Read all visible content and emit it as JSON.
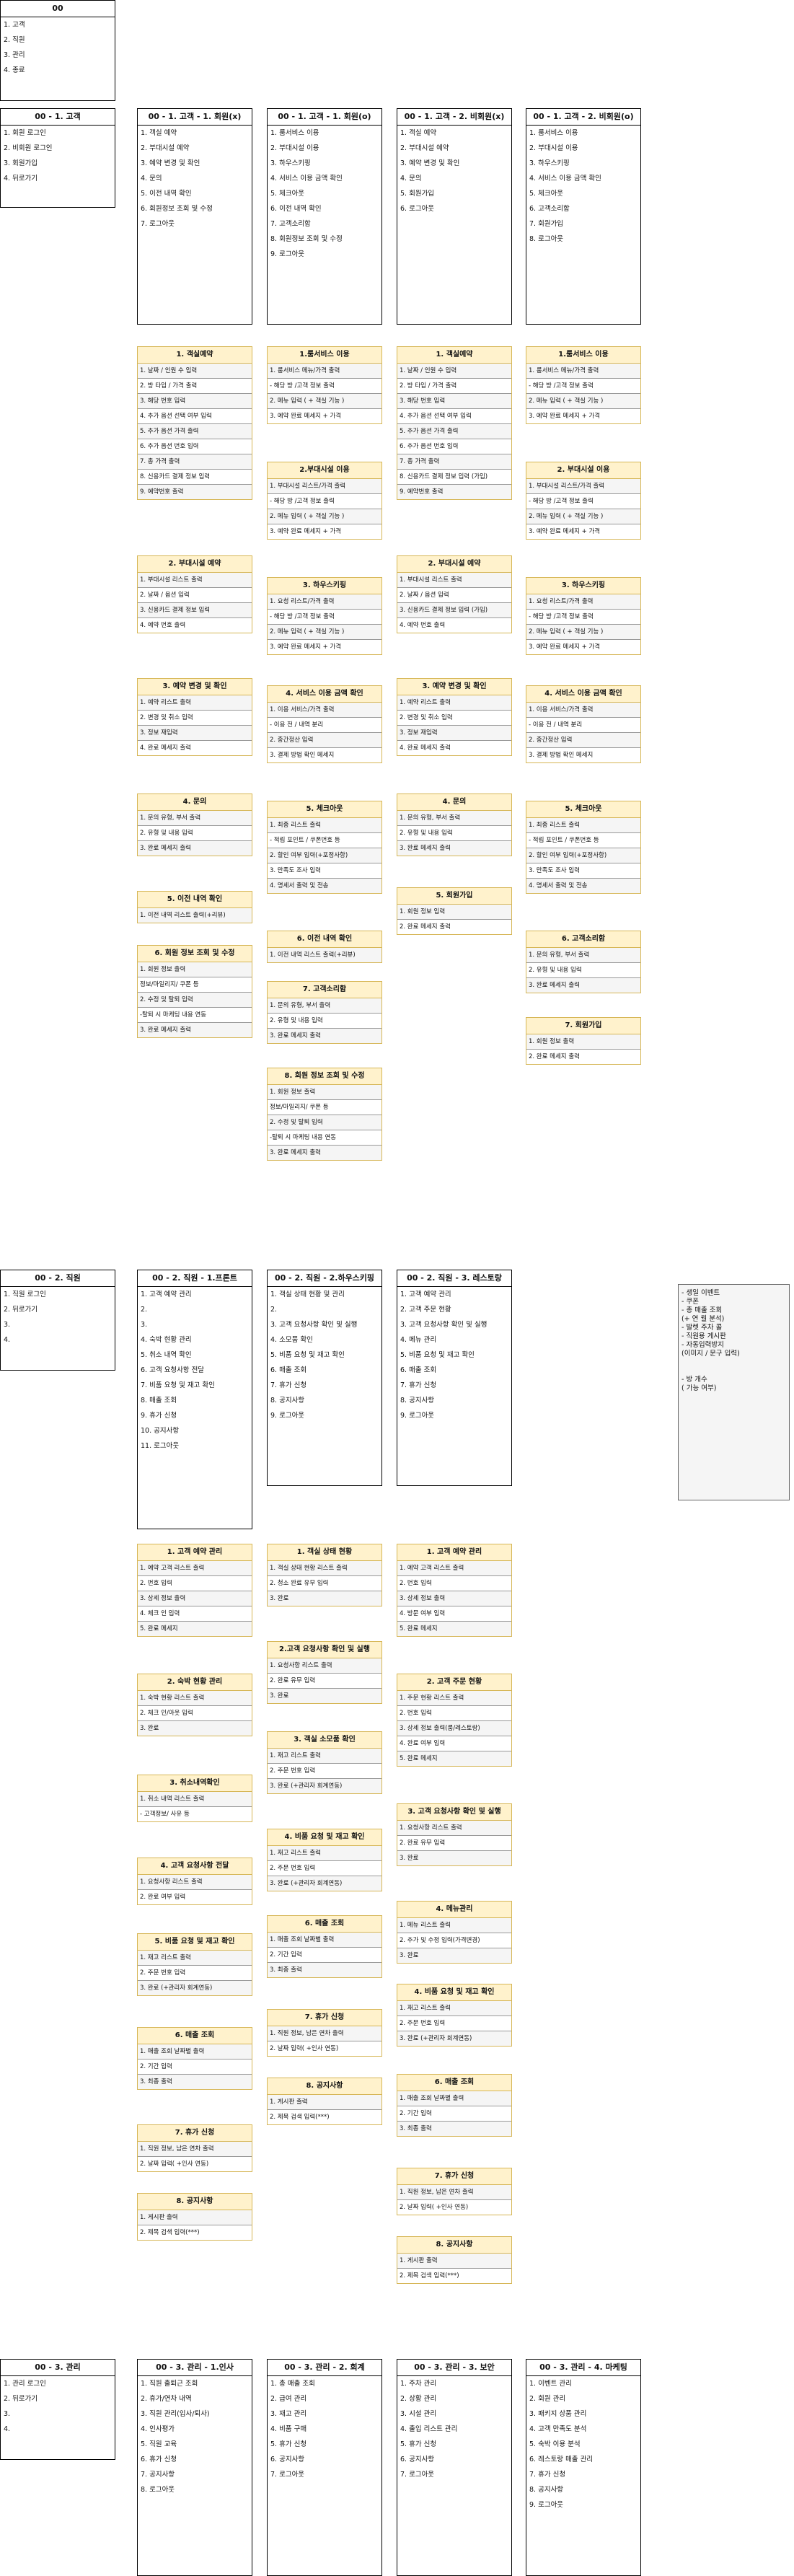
{
  "boxes": [
    {
      "title": "00",
      "lines": [
        "1. 고객",
        "2. 직원",
        "3. 관리",
        "4. 종료"
      ]
    },
    {
      "title": "00 - 1. 고객",
      "lines": [
        "1. 회원 로그인",
        "2. 비회원 로그인",
        "3. 회원가입",
        "4. 뒤로가기"
      ]
    },
    {
      "title": "00 - 1. 고객 - 1. 회원(x)",
      "lines": [
        "1. 객실 예약",
        "2. 부대시설 예약",
        "3. 예약 변경 및 확인",
        "4. 문의",
        "5. 이전 내역 확인",
        "6. 회원정보 조회 및 수정",
        "7. 로그아웃"
      ]
    },
    {
      "title": "00 - 1. 고객 - 1. 회원(o)",
      "lines": [
        "1. 룸서비스 이용",
        "2. 부대시설 이용",
        "3. 하우스키핑",
        "4. 서비스 이용 금액 확인",
        "5. 체크아웃",
        "6. 이전 내역 확인",
        "7. 고객소리함",
        "8. 회원정보 조회 및 수정",
        "9. 로그아웃"
      ]
    },
    {
      "title": "00 - 1. 고객 - 2. 비회원(x)",
      "lines": [
        "1. 객실 예약",
        "2. 부대시설 예약",
        "3. 예약 변경 및 확인",
        "4. 문의",
        "5. 회원가입",
        "6. 로그아웃"
      ]
    },
    {
      "title": "00 - 1. 고객 - 2. 비회원(o)",
      "lines": [
        "1. 룸서비스 이용",
        "2. 부대시설 이용",
        "3. 하우스키핑",
        "4. 서비스 이용 금액 확인",
        "5. 체크아웃",
        "6. 고객소리함",
        "7. 회원가입",
        "8. 로그아웃"
      ]
    },
    {
      "title": "00 - 2. 직원",
      "lines": [
        "1. 직원 로그인",
        "2. 뒤로가기",
        "3.",
        "4."
      ]
    },
    {
      "title": "00 - 2. 직원 - 1.프론트",
      "lines": [
        "1. 고객 예약 관리",
        "2.",
        "3.",
        "4. 숙박 현황 관리",
        "5. 취소 내역 확인",
        "6. 고객 요청사항 전달",
        "7. 비품 요청 및 재고 확인",
        "8. 매출 조회",
        "9. 휴가 신청",
        "10. 공지사항",
        "11. 로그아웃"
      ]
    },
    {
      "title": "00 - 2. 직원 - 2.하우스키핑",
      "lines": [
        "1. 객실 상태 현황 및 관리",
        "2.",
        "3. 고객 요청사항 확인 및 실행",
        "4. 소모품 확인",
        "5. 비품 요청 및 재고 확인",
        "6. 매출 조회",
        "7. 휴가 신청",
        "8. 공지사항",
        "9. 로그아웃"
      ]
    },
    {
      "title": "00 - 2. 직원 - 3. 레스토랑",
      "lines": [
        "1. 고객 예약 관리",
        "2. 고객 주문 현황",
        "3. 고객 요청사항 확인 및 실행",
        "4. 메뉴 관리",
        "5. 비품 요청 및 재고 확인",
        "6. 매출 조회",
        "7. 휴가 신청",
        "8. 공지사항",
        "9. 로그아웃"
      ]
    },
    {
      "title": "00 - 3. 관리",
      "lines": [
        "1. 관리 로그인",
        "2. 뒤로가기",
        "3.",
        "4."
      ]
    },
    {
      "title": "00 - 3. 관리 - 1.인사",
      "lines": [
        "1. 직원 출퇴근 조회",
        "2. 휴가/연차 내역",
        "3. 직원 관리(입사/퇴사)",
        "4. 인사평가",
        "5. 직원 교육",
        "6. 휴가 신청",
        "7. 공지사항",
        "8. 로그아웃"
      ]
    },
    {
      "title": "00 - 3. 관리 - 2. 회계",
      "lines": [
        "1. 총 매출 조회",
        "2. 급여 관리",
        "3. 재고 관리",
        "4. 비품 구매",
        "5. 휴가 신청",
        "6. 공지사항",
        "7. 로그아웃"
      ]
    },
    {
      "title": "00 - 3. 관리 - 3. 보안",
      "lines": [
        "1. 주차 관리",
        "2. 상황 관리",
        "3. 시설 관리",
        "4. 출입 리스트 관리",
        "5. 휴가 신청",
        "6. 공지사항",
        "7. 로그아웃"
      ]
    },
    {
      "title": "00 - 3. 관리 - 4. 마케팅",
      "lines": [
        "1. 이벤트 관리",
        "2. 회원 관리",
        "3. 패키지 상품 관리",
        "4. 고객 만족도 분석",
        "5. 숙박 이용 분석",
        "6. 레스토랑 매출 관리",
        "7. 휴가 신청",
        "8. 공지사항",
        "9. 로그아웃"
      ]
    }
  ],
  "cards": [
    {
      "title": "1. 객실예약",
      "rows": [
        "1. 날짜 / 인원 수 입력",
        "2. 방 타입 / 가격 출력",
        "3. 해당 번호 입력",
        "4. 추가 옵션 선택 여부 입력",
        "5. 추가 옵션 가격 출력",
        "6. 추가 옵션 번호 입력",
        "7. 총 가격 출력",
        "8. 신용카드 결제 정보 입력",
        "9. 예약번호 출력"
      ]
    },
    {
      "title": "2. 부대시설 예약",
      "rows": [
        "1. 부대시설 리스트 출력",
        "2. 날짜 / 옵션 입력",
        "3. 신용카드 결제 정보 입력",
        "4. 예약 번호 출력"
      ]
    },
    {
      "title": "3. 예약 변경 및 확인",
      "rows": [
        "1. 예약 리스트 출력",
        "2. 변경 및 취소 입력",
        "3. 정보 재입력",
        "4. 완료 메세지 출력"
      ]
    },
    {
      "title": "4. 문의",
      "rows": [
        "1. 문의 유형, 부서 출력",
        "2. 유형 및 내용 입력",
        "3. 완료 메세지 출력"
      ]
    },
    {
      "title": "5. 이전 내역 확인",
      "rows": [
        "1. 이전 내역 리스트 출력(+리뷰)"
      ]
    },
    {
      "title": "6. 회원 정보 조회 및 수정",
      "rows": [
        "1. 회원 정보 출력",
        "정보/마일리지/ 쿠폰 등",
        "2. 수정 및 탈퇴 입력",
        "-탈퇴 시 마케팅 내용 연동",
        "3. 완료 메세지 출력"
      ]
    },
    {
      "title": "1.룸서비스 이용",
      "rows": [
        "1. 룸서비스 메뉴/가격 출력",
        "- 해당 방 /고객 정보 출력",
        "2. 메뉴 입력 ( + 객실 기능 )",
        "3. 예약 완료 메세지 + 가격"
      ]
    },
    {
      "title": "2.부대시설 이용",
      "rows": [
        "1. 부대시설 리스트/가격 출력",
        "- 해당 방 /고객 정보 출력",
        "2. 메뉴 입력 ( + 객실 기능 )",
        "3. 예약 완료 메세지 + 가격"
      ]
    },
    {
      "title": "3. 하우스키핑",
      "rows": [
        "1. 요청 리스트/가격 출력",
        "- 해당 방 /고객 정보 출력",
        "2. 메뉴 입력 ( + 객실 기능 )",
        "3. 예약 완료 메세지 + 가격"
      ]
    },
    {
      "title": "4. 서비스 이용 금액 확인",
      "rows": [
        "1. 이용 서비스/가격 출력",
        "- 이용 전 / 내역 분리",
        "2. 중간정산 입력",
        "3. 결제 방법 확인 메세지"
      ]
    },
    {
      "title": "5. 체크아웃",
      "rows": [
        "1. 최종 리스트 출력",
        "- 적립 포인트 / 쿠폰번호 등",
        "2. 할인 여부 입력(+포정사항)",
        "3. 만족도 조사 입력",
        "4. 명세서 출력 및 전송"
      ]
    },
    {
      "title": "6. 이전 내역 확인",
      "rows": [
        "1. 이전 내역 리스트 출력(+리뷰)"
      ]
    },
    {
      "title": "7. 고객소리함",
      "rows": [
        "1. 문의 유형, 부서 출력",
        "2. 유형 및 내용 입력",
        "3. 완료 메세지 출력"
      ]
    },
    {
      "title": "8. 회원 정보 조회 및 수정",
      "rows": [
        "1. 회원 정보 출력",
        "정보/마일리지/ 쿠폰 등",
        "2. 수정 및 탈퇴 입력",
        "-탈퇴 시 마케팅 내용 연동",
        "3. 완료 메세지 출력"
      ]
    },
    {
      "title": "1. 객실예약",
      "rows": [
        "1. 날짜 / 인원 수 입력",
        "2. 방 타입 / 가격 출력",
        "3. 해당 번호 입력",
        "4. 추가 옵션 선택 여부 입력",
        "5. 추가 옵션 가격 출력",
        "6. 추가 옵션 번호 입력",
        "7. 총 가격 출력",
        "8. 신용카드 결제 정보 입력 (가입)",
        "9. 예약번호 출력"
      ]
    },
    {
      "title": "2. 부대시설 예약",
      "rows": [
        "1. 부대시설 리스트 출력",
        "2. 날짜 / 옵션 입력",
        "3. 신용카드 결제 정보 입력 (가입)",
        "4. 예약 번호 출력"
      ]
    },
    {
      "title": "3. 예약 변경 및 확인",
      "rows": [
        "1. 예약 리스트 출력",
        "2. 변경 및 취소 입력",
        "3. 정보 재입력",
        "4. 완료 메세지 출력"
      ]
    },
    {
      "title": "4. 문의",
      "rows": [
        "1. 문의 유형, 부서 출력",
        "2. 유형 및 내용 입력",
        "3. 완료 메세지 출력"
      ]
    },
    {
      "title": "5. 회원가입",
      "rows": [
        "1. 회원 정보 입력",
        "2. 완료 메세지 출력"
      ]
    },
    {
      "title": "1.룸서비스 이용",
      "rows": [
        "1. 룸서비스 메뉴/가격 출력",
        "- 해당 방 /고객 정보 출력",
        "2. 메뉴 입력 ( + 객실 기능 )",
        "3. 예약 완료 메세지 + 가격"
      ]
    },
    {
      "title": "2. 부대시설 이용",
      "rows": [
        "1. 부대시설 리스트/가격 출력",
        "- 해당 방 /고객 정보 출력",
        "2. 메뉴 입력 ( + 객실 기능 )",
        "3. 예약 완료 메세지 + 가격"
      ]
    },
    {
      "title": "3. 하우스키핑",
      "rows": [
        "1. 요청 리스트/가격 출력",
        "- 해당 방 /고객 정보 출력",
        "2. 메뉴 입력 ( + 객실 기능 )",
        "3. 예약 완료 메세지 + 가격"
      ]
    },
    {
      "title": "4. 서비스 이용 금액 확인",
      "rows": [
        "1. 이용 서비스/가격 출력",
        "- 이용 전 / 내역 분리",
        "2. 중간정산 입력",
        "3. 결제 방법 확인 메세지"
      ]
    },
    {
      "title": "5. 체크아웃",
      "rows": [
        "1. 최종 리스트 출력",
        "- 적립 포인트 / 쿠폰번호 등",
        "2. 할인 여부 입력(+포정사항)",
        "3. 만족도 조사 입력",
        "4. 명세서 출력 및 전송"
      ]
    },
    {
      "title": "6. 고객소리함",
      "rows": [
        "1. 문의 유형, 부서 출력",
        "2. 유형 및 내용 입력",
        "3. 완료 메세지 출력"
      ]
    },
    {
      "title": "7. 회원가입",
      "rows": [
        "1. 회원 정보 출력",
        "2. 완료 메세지 출력"
      ]
    },
    {
      "title": "1. 고객 예약 관리",
      "rows": [
        "1. 예약 고객 리스트 출력",
        "2. 번호 입력",
        "3. 상세 정보 출력",
        "4. 체크 인 입력",
        "5. 완료 메세지"
      ]
    },
    {
      "title": "2. 숙박 현황 관리",
      "rows": [
        "1. 숙박 현황 리스트 출력",
        "2. 체크 인/아웃 입력",
        "3. 완료"
      ]
    },
    {
      "title": "3. 취소내역확인",
      "rows": [
        "1. 취소 내역 리스트 출력",
        "- 고객정보/ 사유 등"
      ]
    },
    {
      "title": "4. 고객 요청사항 전달",
      "rows": [
        "1. 요청사항 리스트 출력",
        "2. 완료 여부 입력"
      ]
    },
    {
      "title": "5. 비품 요청 및 재고 확인",
      "rows": [
        "1. 재고 리스트 출력",
        "2. 주문 번호 입력",
        "3. 완료 (+관리자 회계연동)"
      ]
    },
    {
      "title": "6. 매출 조회",
      "rows": [
        "1. 매출 조회 날짜별 출력",
        "2. 기간 입력",
        "3. 최종 출력"
      ]
    },
    {
      "title": "7. 휴가 신청",
      "rows": [
        "1. 직원 정보, 남은 연차 출력",
        "2. 날짜 입력( +인사 연동)"
      ]
    },
    {
      "title": "8. 공지사항",
      "rows": [
        "1. 게시판 출력",
        "2. 제목 검색 입력(***)"
      ]
    },
    {
      "title": "1. 객실 상태 현황",
      "rows": [
        "1. 객실 상태 현황 리스트 출력",
        "2. 청소 완료 유무 입력",
        "3. 완료"
      ]
    },
    {
      "title": "2.고객 요청사항 확인 및 실행",
      "rows": [
        "1. 요청사항 리스트 출력",
        "2. 완료 유무 입력",
        "3. 완료"
      ]
    },
    {
      "title": "3. 객실 소모품 확인",
      "rows": [
        "1. 재고 리스트 출력",
        "2. 주문 번호 입력",
        "3. 완료 (+관리자 회계연동)"
      ]
    },
    {
      "title": "4. 비품 요청 및 재고 확인",
      "rows": [
        "1. 재고 리스트 출력",
        "2. 주문 번호 입력",
        "3. 완료 (+관리자 회계연동)"
      ]
    },
    {
      "title": "6. 매출 조회",
      "rows": [
        "1. 매출 조회 날짜별 출력",
        "2. 기간 입력",
        "3. 최종 출력"
      ]
    },
    {
      "title": "7. 휴가 신청",
      "rows": [
        "1. 직원 정보, 남은 연차 출력",
        "2. 날짜 입력( +인사 연동)"
      ]
    },
    {
      "title": "8. 공지사항",
      "rows": [
        "1. 게시판 출력",
        "2. 제목 검색 입력(***)"
      ]
    },
    {
      "title": "1. 고객 예약 관리",
      "rows": [
        "1. 예약 고객 리스트 출력",
        "2. 번호 입력",
        "3. 상세 정보 출력",
        "4. 방문 여부 입력",
        "5. 완료 메세지"
      ]
    },
    {
      "title": "2. 고객 주문 현황",
      "rows": [
        "1. 주문 현황 리스트 출력",
        "2. 번호 입력",
        "3. 상세 정보 출력(룸/레스토랑)",
        "4. 완료 여부 입력",
        "5. 완료 메세지"
      ]
    },
    {
      "title": "3. 고객 요청사항 확인 및 실행",
      "rows": [
        "1. 요청사항 리스트 출력",
        "2. 완료 유무 입력",
        "3. 완료"
      ]
    },
    {
      "title": "4. 메뉴관리",
      "rows": [
        "1. 메뉴 리스트 출력",
        "2. 추가 및 수정 입력(가격변경)",
        "3. 완료"
      ]
    },
    {
      "title": "4. 비품 요청 및 재고 확인",
      "rows": [
        "1. 재고 리스트 출력",
        "2. 주문 번호 입력",
        "3. 완료 (+관리자 회계연동)"
      ]
    },
    {
      "title": "6. 매출 조회",
      "rows": [
        "1. 매출 조회 날짜별 출력",
        "2. 기간 입력",
        "3. 최종 출력"
      ]
    },
    {
      "title": "7. 휴가 신청",
      "rows": [
        "1. 직원 정보, 남은 연차 출력",
        "2. 날짜 입력( +인사 연동)"
      ]
    },
    {
      "title": "8. 공지사항",
      "rows": [
        "1. 게시판 출력",
        "2. 제목 검색 입력(***)"
      ]
    }
  ],
  "note": {
    "lines": [
      "- 생일 이벤트",
      "- 쿠폰",
      "- 총 매출 조회",
      "(+ 연 월 분석)",
      "- 발렛 주차 콜",
      "- 직원용 게시판",
      "- 자동입력방지",
      "(이미지 / 문구 입력)",
      "",
      "",
      "- 방 개수",
      "( 가능 여부)"
    ]
  }
}
